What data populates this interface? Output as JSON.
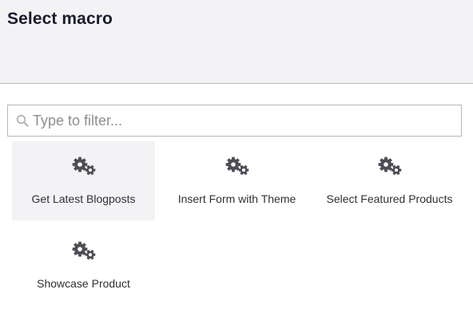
{
  "header": {
    "title": "Select macro"
  },
  "filter": {
    "placeholder": "Type to filter...",
    "value": "",
    "icon": "search-icon"
  },
  "macros": [
    {
      "label": "Get Latest Blogposts",
      "icon": "cogs-icon",
      "selected": true
    },
    {
      "label": "Insert Form with Theme",
      "icon": "cogs-icon",
      "selected": false
    },
    {
      "label": "Select Featured Products",
      "icon": "cogs-icon",
      "selected": false
    },
    {
      "label": "Showcase Product",
      "icon": "cogs-icon",
      "selected": false
    }
  ],
  "colors": {
    "header_bg": "#f3f3f5",
    "selected_tile_bg": "#f3f3f5",
    "icon": "#4d4d55",
    "border": "#b7b7bd"
  }
}
